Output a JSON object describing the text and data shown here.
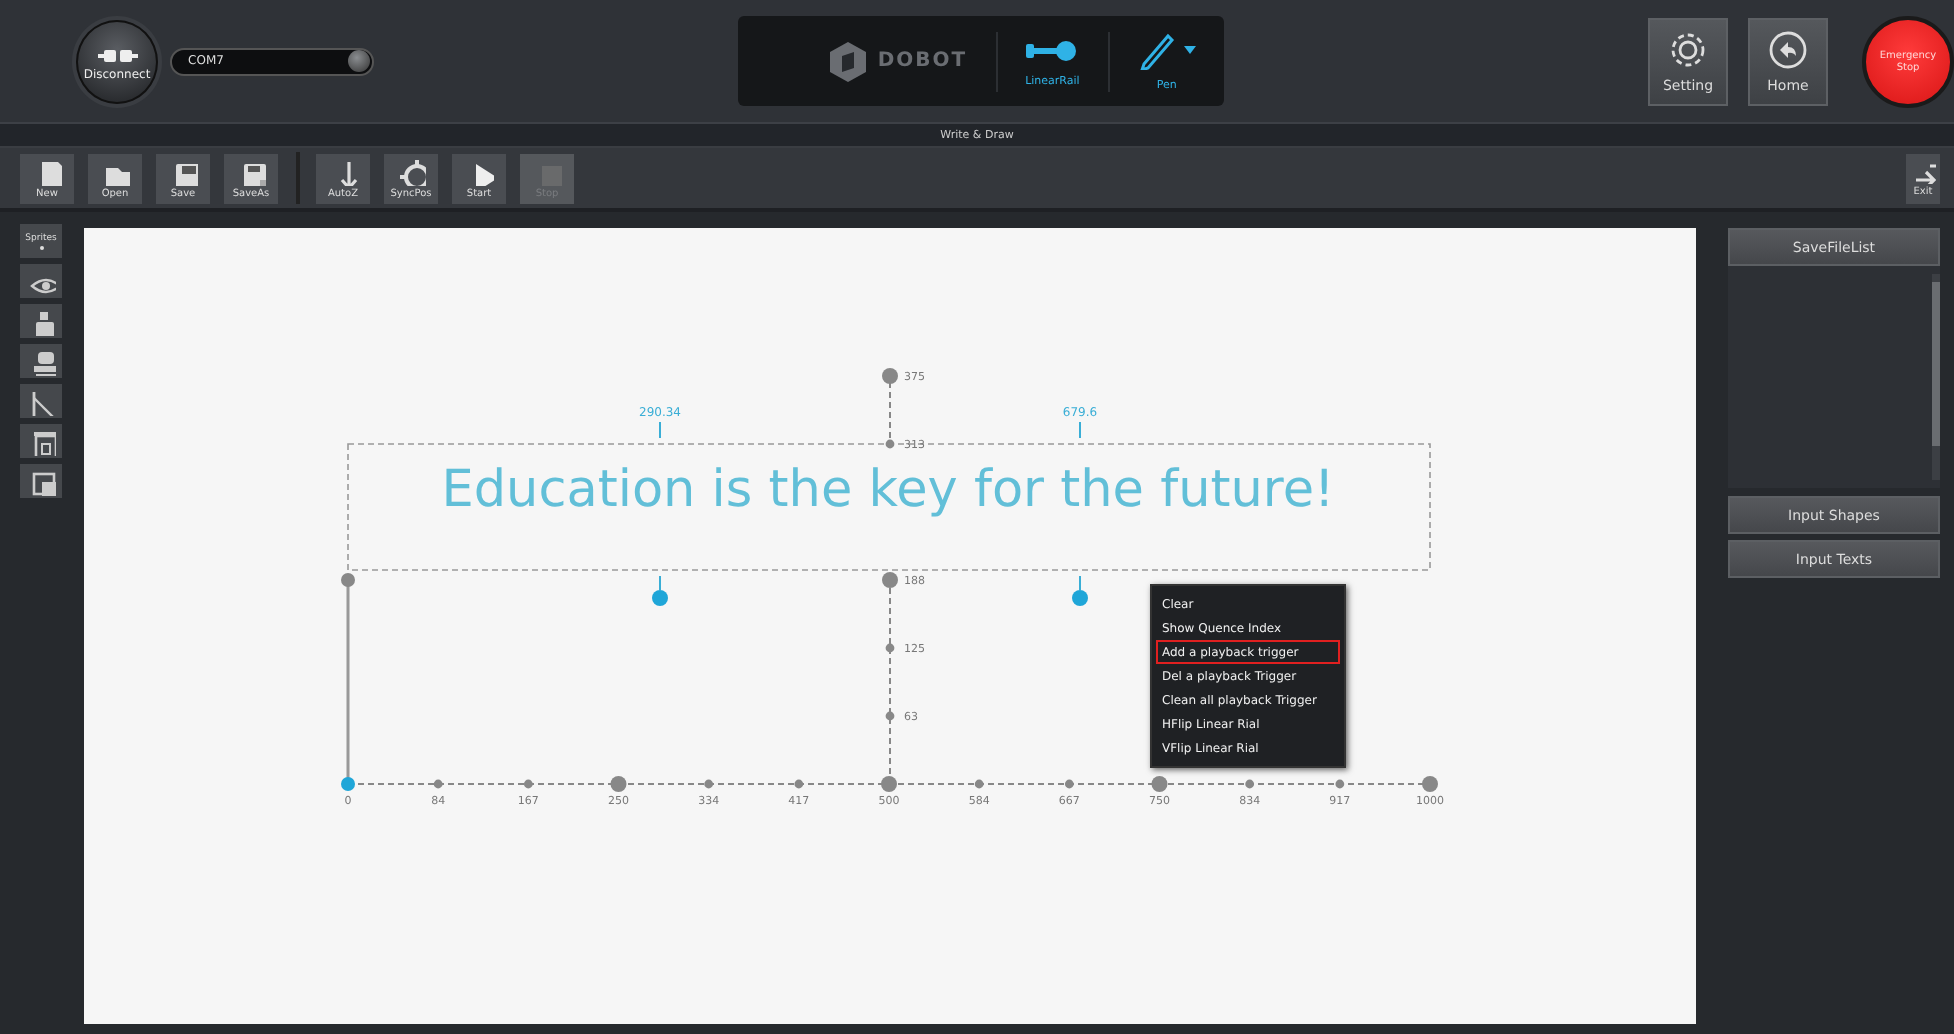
{
  "header": {
    "connect_button": "Disconnect",
    "port": "COM7",
    "brand": "DOBOT",
    "tools": [
      {
        "kind": "rail",
        "label": "LinearRail"
      },
      {
        "kind": "pen",
        "label": "Pen"
      }
    ],
    "actions": [
      {
        "kind": "gear",
        "label": "Setting"
      },
      {
        "kind": "home",
        "label": "Home"
      }
    ],
    "emergency_stop": "Emergency Stop"
  },
  "title": "Write & Draw",
  "file_tools": [
    {
      "label": "New",
      "disabled": false
    },
    {
      "label": "Open",
      "disabled": false
    },
    {
      "label": "Save",
      "disabled": false
    },
    {
      "label": "SaveAs",
      "disabled": false
    }
  ],
  "run_tools": [
    {
      "label": "AutoZ",
      "disabled": false
    },
    {
      "label": "SyncPos",
      "disabled": false
    },
    {
      "label": "Start",
      "disabled": false
    },
    {
      "label": "Stop",
      "disabled": true
    }
  ],
  "exit_button": "Exit",
  "side_tools": {
    "label": "Sprites"
  },
  "canvas": {
    "text": "Education is the key for the future!",
    "x_labels": [
      "0",
      "84",
      "167",
      "250",
      "334",
      "417",
      "500",
      "584",
      "667",
      "750",
      "834",
      "917",
      "1000"
    ],
    "y_labels": [
      "375",
      "313",
      "188",
      "125",
      "63"
    ],
    "triggers": [
      {
        "label": "290.34"
      },
      {
        "label": "679.6"
      }
    ],
    "context_menu": [
      {
        "label": "Clear",
        "selected": false
      },
      {
        "label": "Show Quence Index",
        "selected": false
      },
      {
        "label": "Add a playback trigger",
        "selected": true
      },
      {
        "label": "Del a playback Trigger",
        "selected": false
      },
      {
        "label": "Clean all playback Trigger",
        "selected": false
      },
      {
        "label": "HFlip Linear Rial",
        "selected": false
      },
      {
        "label": "VFlip Linear Rial",
        "selected": false
      }
    ]
  },
  "right_panel": {
    "list_button": "SaveFileList",
    "buttons": [
      "Input Shapes",
      "Input Texts"
    ]
  }
}
